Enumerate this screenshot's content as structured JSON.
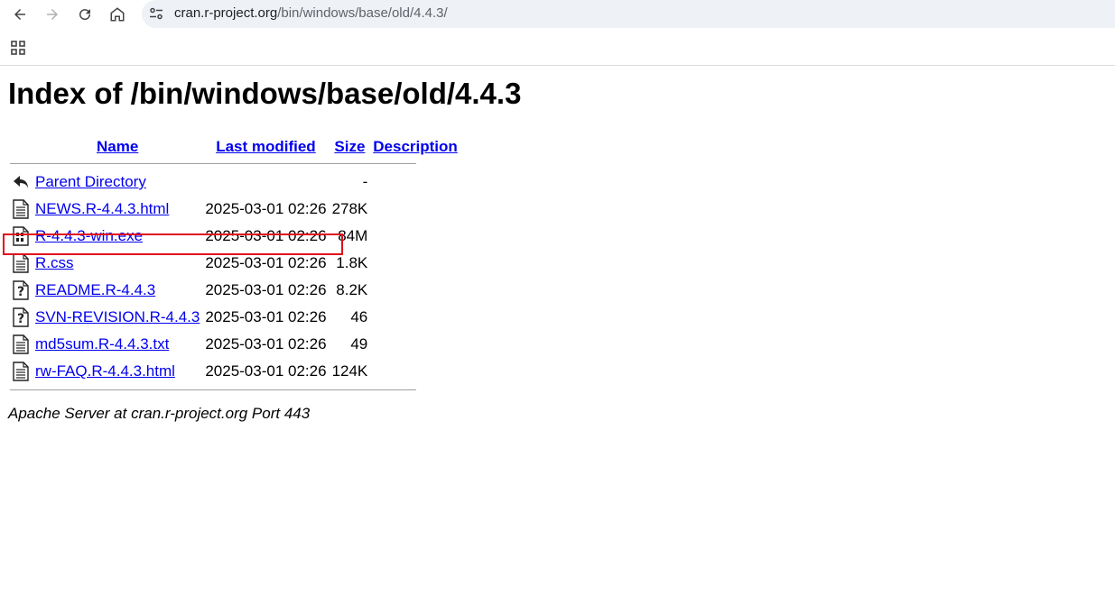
{
  "browser": {
    "url_domain": "cran.r-project.org",
    "url_path": "/bin/windows/base/old/4.4.3/"
  },
  "page": {
    "title": "Index of /bin/windows/base/old/4.4.3",
    "columns": {
      "name": "Name",
      "last_modified": "Last modified",
      "size": "Size",
      "description": "Description"
    },
    "rows": [
      {
        "icon": "back-folder-icon",
        "name": "Parent Directory",
        "modified": "",
        "size": "-"
      },
      {
        "icon": "text-file-icon",
        "name": "NEWS.R-4.4.3.html",
        "modified": "2025-03-01 02:26",
        "size": "278K"
      },
      {
        "icon": "binary-file-icon",
        "name": "R-4.4.3-win.exe",
        "modified": "2025-03-01 02:26",
        "size": "84M"
      },
      {
        "icon": "text-file-icon",
        "name": "R.css",
        "modified": "2025-03-01 02:26",
        "size": "1.8K"
      },
      {
        "icon": "unknown-file-icon",
        "name": "README.R-4.4.3",
        "modified": "2025-03-01 02:26",
        "size": "8.2K"
      },
      {
        "icon": "unknown-file-icon",
        "name": "SVN-REVISION.R-4.4.3",
        "modified": "2025-03-01 02:26",
        "size": "46"
      },
      {
        "icon": "text-file-icon",
        "name": "md5sum.R-4.4.3.txt",
        "modified": "2025-03-01 02:26",
        "size": "49"
      },
      {
        "icon": "text-file-icon",
        "name": "rw-FAQ.R-4.4.3.html",
        "modified": "2025-03-01 02:26",
        "size": "124K"
      }
    ],
    "footer": "Apache Server at cran.r-project.org Port 443"
  },
  "colors": {
    "link": "#0000ee",
    "highlight": "#e0101c"
  }
}
